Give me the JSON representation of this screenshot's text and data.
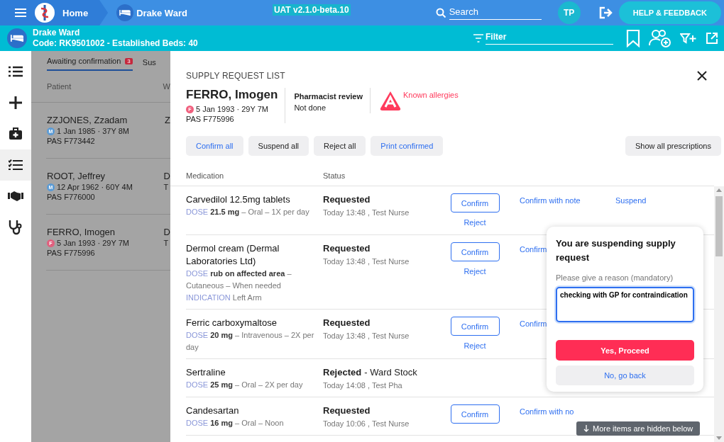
{
  "topbar": {
    "home": "Home",
    "ward": "Drake Ward",
    "version": "UAT v2.1.0-beta.10",
    "search": {
      "placeholder": "Search"
    },
    "avatar": "TP",
    "help": "HELP & FEEDBACK"
  },
  "ward_bar": {
    "name": "Drake Ward",
    "code": "Code: RK9501002 - Established Beds: 40",
    "filter": {
      "placeholder": "Filter"
    }
  },
  "nav": [
    {
      "kind": "list",
      "selected": false
    },
    {
      "kind": "plus",
      "selected": false
    },
    {
      "kind": "kit",
      "selected": false
    },
    {
      "kind": "checklist",
      "selected": true
    },
    {
      "kind": "handshake",
      "selected": false
    },
    {
      "kind": "stethoscope",
      "selected": false
    }
  ],
  "list": {
    "tabs": [
      {
        "label": "Awaiting confirmation",
        "badge": "3",
        "selected": true
      },
      {
        "label": "Sus",
        "selected": false
      }
    ],
    "columns": [
      "Patient",
      "W"
    ],
    "rows": [
      {
        "name": "ZZJONES, Zzadam",
        "sex": "M",
        "color": "#5b9bd5",
        "dob": "1 Jan 1985 · 37Y 8M",
        "pas": "PAS F773442",
        "column_2": [
          "Z"
        ]
      },
      {
        "name": "ROOT, Jeffrey",
        "sex": "M",
        "color": "#5b9bd5",
        "dob": "12 Apr 1962 · 60Y 4M",
        "pas": "PAS F776000",
        "column_2": [
          "D",
          "T"
        ]
      },
      {
        "name": "FERRO, Imogen",
        "sex": "F",
        "color": "#e0607e",
        "dob": "5 Jan 1993 · 29Y 7M",
        "pas": "PAS F775996",
        "column_2": [
          "D",
          "T"
        ]
      }
    ]
  },
  "panel": {
    "title": "SUPPLY REQUEST LIST",
    "patient": {
      "name": "FERRO, Imogen",
      "sex": "F",
      "color": "#f0607e",
      "dob": "5 Jan 1993 · 29Y 7M",
      "pas": "PAS F775996"
    },
    "review": {
      "label": "Pharmacist review",
      "value": "Not done"
    },
    "allergies": "Known allergies",
    "buttons": [
      {
        "label": "Confirm all",
        "kind": "primary"
      },
      {
        "label": "Suspend all",
        "kind": "plain"
      },
      {
        "label": "Reject all",
        "kind": "plain"
      },
      {
        "label": "Print confirmed",
        "kind": "primary"
      }
    ],
    "show_all": "Show all prescriptions",
    "columns": [
      "Medication",
      "Status"
    ],
    "rows": [
      {
        "name": "Carvedilol 12.5mg tablets",
        "dose_label": "DOSE",
        "dose": "**21.5 mg** – Oral – 1X per day",
        "status": "Requested",
        "when": "Today 13:48 , Test Nurse",
        "actions": {
          "confirm": "Confirm",
          "reject": "Reject",
          "note": "Confirm with note",
          "suspend": "Suspend"
        }
      },
      {
        "name": "Dermol cream (Dermal Laboratories Ltd)",
        "dose_label": "DOSE",
        "dose": "**rub on affected area** – Cutaneous – When needed",
        "indication_label": "INDICATION",
        "indication": "Left Arm",
        "status": "Requested",
        "when": "Today 13:48 , Test Nurse",
        "actions": {
          "confirm": "Confirm",
          "reject": "Reject",
          "note": "Confirm"
        }
      },
      {
        "name": "Ferric carboxymaltose",
        "dose_label": "DOSE",
        "dose": "**20 mg** – Intravenous – 2X per day",
        "status": "Requested",
        "when": "Today 13:48 , Test Nurse",
        "actions": {
          "confirm": "Confirm",
          "reject": "Reject",
          "note": "Confirm"
        }
      },
      {
        "name": "Sertraline",
        "dose_label": "DOSE",
        "dose": "**25 mg** – Oral – 2X per day",
        "status": "Rejected",
        "status_note": "- Ward Stock",
        "when": "Today 14:08 , Test Pha"
      },
      {
        "name": "Candesartan",
        "dose_label": "DOSE",
        "dose": "**16 mg** – Oral – Noon",
        "status": "Requested",
        "when": "Today 10:06 , Test Nurse",
        "actions": {
          "confirm": "Confirm",
          "note": "Confirm with no"
        }
      }
    ],
    "popover": {
      "title": "You are suspending supply request",
      "label": "Please give a reason (mandatory)",
      "value": "checking with GP for contraindication",
      "proceed": "Yes, Proceed",
      "back": "No, go back"
    },
    "hidden_note": "More items are hidden below"
  }
}
